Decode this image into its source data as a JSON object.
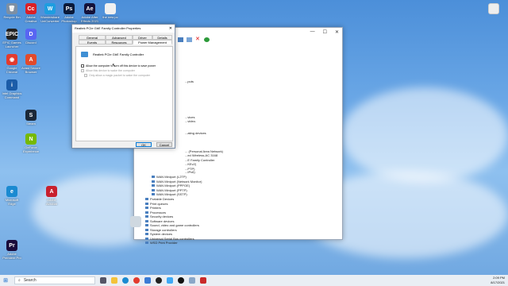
{
  "desktop_icons": [
    {
      "label": "Recycle Bin",
      "color": "#7d8fa3",
      "glyph": "🗑"
    },
    {
      "label": "Adobe Creative Cloud",
      "color": "#da1f26",
      "glyph": "Cc"
    },
    {
      "label": "Wondershare UniConverter",
      "color": "#1e9de0",
      "glyph": "W"
    },
    {
      "label": "Adobe Photoshop",
      "color": "#0a1a3a",
      "glyph": "Ps"
    },
    {
      "label": "Adobe After Effects 2021",
      "color": "#14123a",
      "glyph": "Ae"
    },
    {
      "label": "the new pc",
      "color": "#f0f0f0",
      "glyph": ""
    },
    {
      "label": "EPIC Games Launcher",
      "color": "#222222",
      "glyph": "EPIC"
    },
    {
      "label": "Discord",
      "color": "#5865f2",
      "glyph": "D"
    },
    {
      "label": "Google Chrome",
      "color": "#e33b2e",
      "glyph": "◉"
    },
    {
      "label": "Avast Secure Browser",
      "color": "#e24a2b",
      "glyph": "A"
    },
    {
      "label": "Intel Graphics Command Center",
      "color": "#1b5ca8",
      "glyph": "i"
    },
    {
      "label": "Steam",
      "color": "#1b2838",
      "glyph": "S"
    },
    {
      "label": "GeForce Experience",
      "color": "#76b900",
      "glyph": "N"
    },
    {
      "label": "Adobe Premiere Pro",
      "color": "#1a0b3b",
      "glyph": "Pr"
    },
    {
      "label": "Microsoft Edge",
      "color": "#1a8ad1",
      "glyph": "e"
    },
    {
      "label": "Adobe Acrobat",
      "color": "#c8202e",
      "glyph": "A"
    }
  ],
  "device_manager": {
    "title_controls": [
      "—",
      "☐",
      "✕"
    ],
    "tree": [
      {
        "text": "...puts",
        "indent": 0
      },
      {
        "text": "...vices",
        "indent": 0
      },
      {
        "text": "...video.",
        "indent": 0
      },
      {
        "text": "...ating devices",
        "indent": 0
      },
      {
        "text": "... (Personal Area Network)",
        "indent": 0
      },
      {
        "text": "...ed Wireless-AC 3168",
        "indent": 0
      },
      {
        "text": "...E Family Controller",
        "indent": 0
      },
      {
        "text": "...KEv2)",
        "indent": 0
      },
      {
        "text": "...PTP)",
        "indent": 0
      },
      {
        "text": "...IPv6)",
        "indent": 0
      },
      {
        "text": "WAN Miniport (L2TP)",
        "indent": 1
      },
      {
        "text": "WAN Miniport (Network Monitor)",
        "indent": 1
      },
      {
        "text": "WAN Miniport (PPPOE)",
        "indent": 1
      },
      {
        "text": "WAN Miniport (PPTP)",
        "indent": 1
      },
      {
        "text": "WAN Miniport (SSTP)",
        "indent": 1
      },
      {
        "text": "Portable Devices",
        "indent": 0
      },
      {
        "text": "Print queues",
        "indent": 0
      },
      {
        "text": "Printers",
        "indent": 0
      },
      {
        "text": "Processors",
        "indent": 0
      },
      {
        "text": "Security devices",
        "indent": 0
      },
      {
        "text": "Software devices",
        "indent": 0
      },
      {
        "text": "Sound, video and game controllers",
        "indent": 0
      },
      {
        "text": "Storage controllers",
        "indent": 0
      },
      {
        "text": "System devices",
        "indent": 0
      },
      {
        "text": "Universal Serial Bus controllers",
        "indent": 0
      },
      {
        "text": "WSD Print Provider",
        "indent": 0
      }
    ]
  },
  "properties": {
    "title": "Realtek PCIe GbE Family Controller Properties",
    "close": "✕",
    "tabs": [
      "General",
      "Advanced",
      "Driver",
      "Details",
      "Events",
      "Resources",
      "Power Management"
    ],
    "device_name": "Realtek PCIe GbE Family Controller",
    "options": [
      "Allow the computer to turn off this device to save power",
      "Allow this device to wake the computer",
      "Only allow a magic packet to wake the computer"
    ],
    "ok": "OK",
    "cancel": "Cancel"
  },
  "taskbar": {
    "search_placeholder": "Search",
    "time": "2:09 PM",
    "date": "8/17/2021"
  }
}
